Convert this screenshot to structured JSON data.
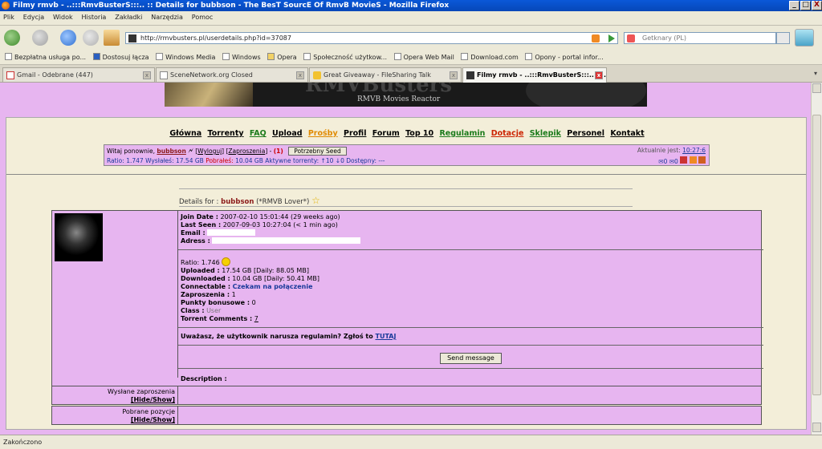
{
  "window": {
    "title": "Filmy rmvb - ..:::RmvBusterS:::.. :: Details for bubbson - The BesT SourcE Of RmvB MovieS - Mozilla Firefox",
    "min": "_",
    "max": "□",
    "close": "X"
  },
  "menu": [
    "Plik",
    "Edycja",
    "Widok",
    "Historia",
    "Zakładki",
    "Narzędzia",
    "Pomoc"
  ],
  "address": {
    "url": "http://rmvbusters.pl/userdetails.php?id=37087"
  },
  "search": {
    "placeholder": "Getknary (PL)"
  },
  "bookmarks": [
    "Bezpłatna usługa po...",
    "Dostosuj łącza",
    "Windows Media",
    "Windows",
    "Opera",
    "Społeczność użytkow...",
    "Opera Web Mail",
    "Download.com",
    "Opony - portal infor..."
  ],
  "tabs": [
    {
      "label": "Gmail - Odebrane (447)"
    },
    {
      "label": "SceneNetwork.org Closed"
    },
    {
      "label": "Great Giveaway - FileSharing Talk"
    },
    {
      "label": "Filmy rmvb - ..:::RmvBusterS:::.. :: ..."
    }
  ],
  "banner": {
    "title": "RMVBusters",
    "subtitle": "RMVB Movies Reactor"
  },
  "site_nav": [
    "Główna",
    "Torrenty",
    "FAQ",
    "Upload",
    "Prośby",
    "Profil",
    "Forum",
    "Top 10",
    "Regulamin",
    "Dotacje",
    "Sklepik",
    "Personel",
    "Kontakt"
  ],
  "site_nav_colors": [
    "#000",
    "#000",
    "#1a7a1a",
    "#000",
    "#e08a00",
    "#000",
    "#000",
    "#000",
    "#1a7a1a",
    "#cc2200",
    "#1a7a1a",
    "#000",
    "#000"
  ],
  "userbox": {
    "welcome": "Witaj ponownie,",
    "username": "bubbson",
    "logout": "Wyloguj",
    "invites": "Zaproszenia",
    "invites_count": "(1)",
    "seed_button": "Potrzebny Seed",
    "ratio_label": "Ratio:",
    "ratio": "1.747",
    "uploaded_label": "Wysłałeś:",
    "uploaded": "17.54 GB",
    "downloaded_label": "Pobrałeś:",
    "downloaded": "10.04 GB",
    "active_label": "Aktywne torrenty:",
    "active_up": "10",
    "active_down": "0",
    "available_label": "Dostępny:",
    "available": "---",
    "time_label": "Aktualnie jest:",
    "time": "10:27:6",
    "msg_count1": "0",
    "msg_count2": "0"
  },
  "details": {
    "heading_prefix": "Details for :",
    "username": "bubbson",
    "class_tag": "(*RMVB Lover*)",
    "join_label": "Join Date :",
    "join": "2007-02-10 15:01:44 (29 weeks ago)",
    "seen_label": "Last Seen :",
    "seen": "2007-09-03 10:27:04 (< 1 min ago)",
    "email_label": "Email :",
    "address_label": "Adress :",
    "ratio_label": "Ratio:",
    "ratio": "1.746",
    "uploaded_label": "Uploaded :",
    "uploaded": "17.54 GB [Daily: 88.05 MB]",
    "downloaded_label": "Downloaded :",
    "downloaded": "10.04 GB [Daily: 50.41 MB]",
    "connectable_label": "Connectable :",
    "connectable": "Czekam na połączenie",
    "invites_label": "Zaproszenia :",
    "invites": "1",
    "bonus_label": "Punkty bonusowe :",
    "bonus": "0",
    "class_label": "Class :",
    "class": "User",
    "comments_label": "Torrent Comments :",
    "comments": "7",
    "report_text": "Uważasz, że użytkownik narusza regulamin? Zgłoś to",
    "report_link": "TUTAJ",
    "send_button": "Send message",
    "description_label": "Description :"
  },
  "sections": [
    {
      "label": "Wysłane zaproszenia",
      "toggle": "[Hide/Show]"
    },
    {
      "label": "Pobrane pozycje",
      "toggle": "[Hide/Show]"
    }
  ],
  "status": "Zakończono",
  "colors": {
    "page_bg": "#e7b5f0",
    "panel_bg": "#f3eed9",
    "username": "#8b1a1a",
    "link_blue": "#1a3a9a"
  }
}
